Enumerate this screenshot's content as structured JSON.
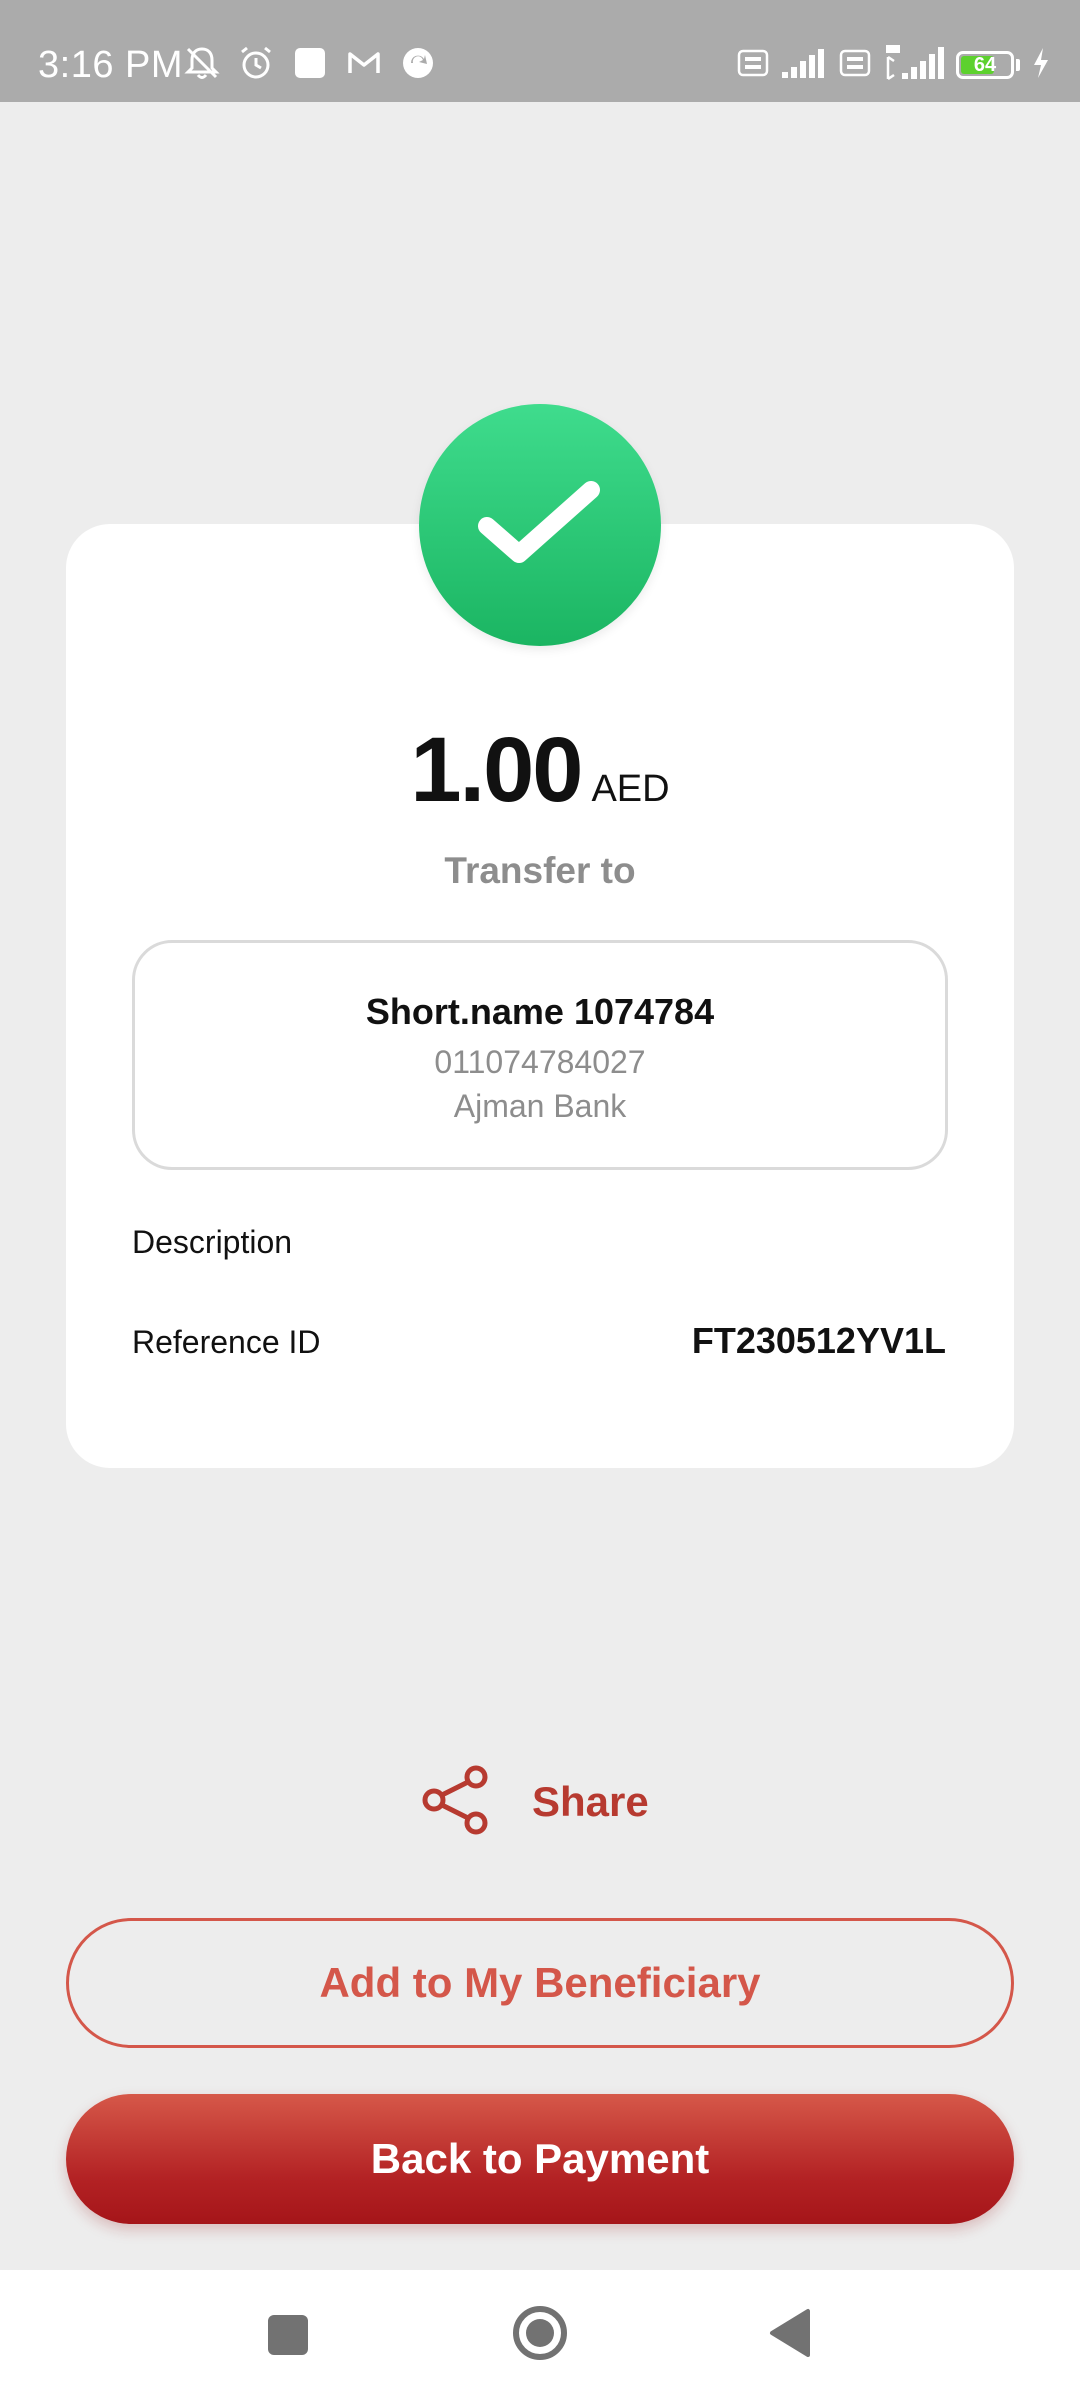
{
  "status_bar": {
    "time": "3:16 PM",
    "battery_level": "64",
    "left_icons": [
      "mute-notifications-icon",
      "alarm-icon",
      "app-square-icon",
      "gmail-icon",
      "sync-app-icon"
    ],
    "right_icons": [
      "volte-icon",
      "signal-icon",
      "volte-icon",
      "4g-signal-icon",
      "battery-icon",
      "charging-icon"
    ]
  },
  "receipt": {
    "amount": "1.00",
    "currency": "AED",
    "transfer_to_label": "Transfer to",
    "beneficiary": {
      "name": "Short.name 1074784",
      "account": "011074784027",
      "bank": "Ajman Bank"
    },
    "description_label": "Description",
    "description_value": "",
    "reference_label": "Reference ID",
    "reference_value": "FT230512YV1L"
  },
  "actions": {
    "share_label": "Share",
    "add_beneficiary_label": "Add to My Beneficiary",
    "back_to_payment_label": "Back to Payment"
  },
  "colors": {
    "accent": "#b73a30",
    "success": "#22c06e",
    "background": "#ededed"
  }
}
